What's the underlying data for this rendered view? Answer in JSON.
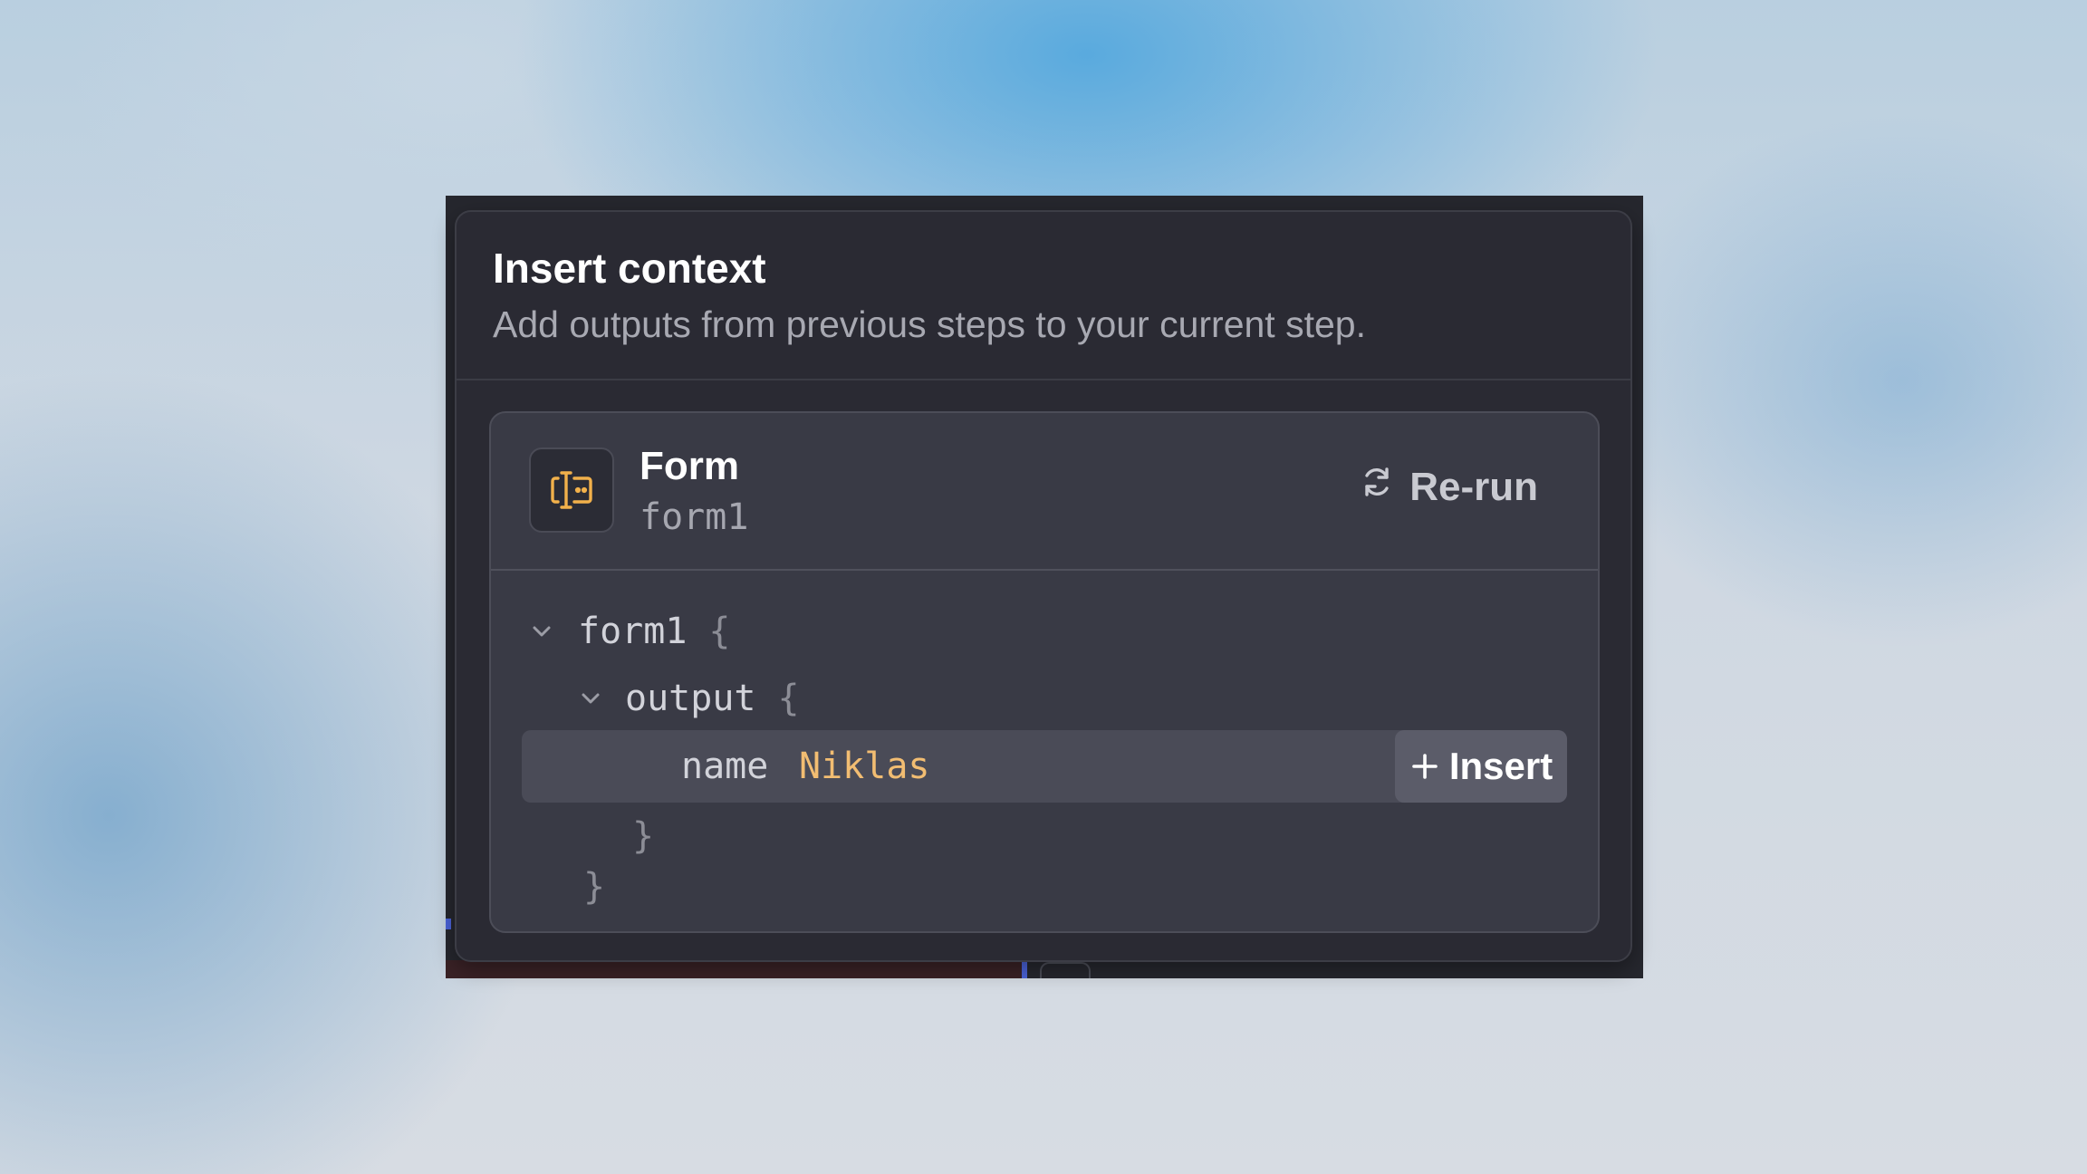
{
  "dialog": {
    "title": "Insert context",
    "subtitle": "Add outputs from previous steps to your current step."
  },
  "step": {
    "icon": "form-input-icon",
    "name": "Form",
    "id": "form1",
    "rerun_label": "Re-run",
    "accent_color": "#f2b14b"
  },
  "tree": {
    "root_key": "form1",
    "open_brace": "{",
    "close_brace": "}",
    "output_key": "output",
    "field": {
      "key": "name",
      "value": "Niklas",
      "insert_label": "Insert"
    }
  }
}
